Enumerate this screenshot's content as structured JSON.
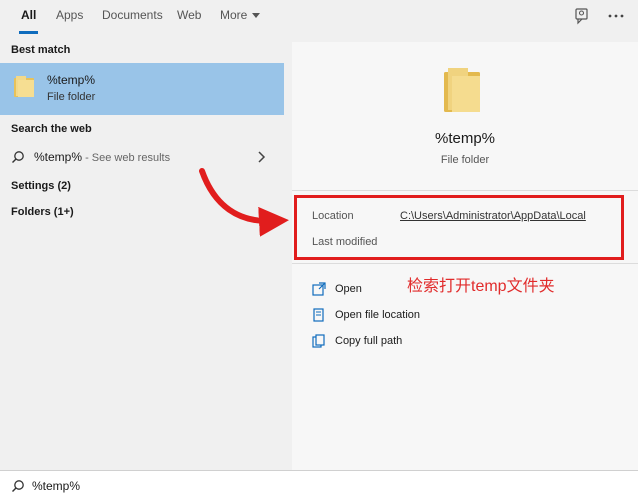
{
  "tabs": [
    {
      "label": "All",
      "active": true
    },
    {
      "label": "Apps"
    },
    {
      "label": "Documents"
    },
    {
      "label": "Web"
    },
    {
      "label": "More"
    }
  ],
  "top_icons": [
    "feedback-icon",
    "more-icon"
  ],
  "left": {
    "best_match_label": "Best match",
    "best_match": {
      "title": "%temp%",
      "subtitle": "File folder"
    },
    "search_web_label": "Search the web",
    "web_result": {
      "query": "%temp%",
      "suffix": " - See web results"
    },
    "settings_label": "Settings (2)",
    "folders_label": "Folders (1+)"
  },
  "detail": {
    "title": "%temp%",
    "subtitle": "File folder",
    "location_label": "Location",
    "location_value": "C:\\Users\\Administrator\\AppData\\Local",
    "modified_label": "Last modified",
    "annotation": "检索打开temp文件夹",
    "actions": [
      {
        "label": "Open",
        "icon": "open-icon"
      },
      {
        "label": "Open file location",
        "icon": "file-location-icon"
      },
      {
        "label": "Copy full path",
        "icon": "copy-icon"
      }
    ]
  },
  "search": {
    "value": "%temp%"
  },
  "colors": {
    "selection": "#99c4e8",
    "accent": "#0f6cbd",
    "annotation": "#e12b2b"
  }
}
